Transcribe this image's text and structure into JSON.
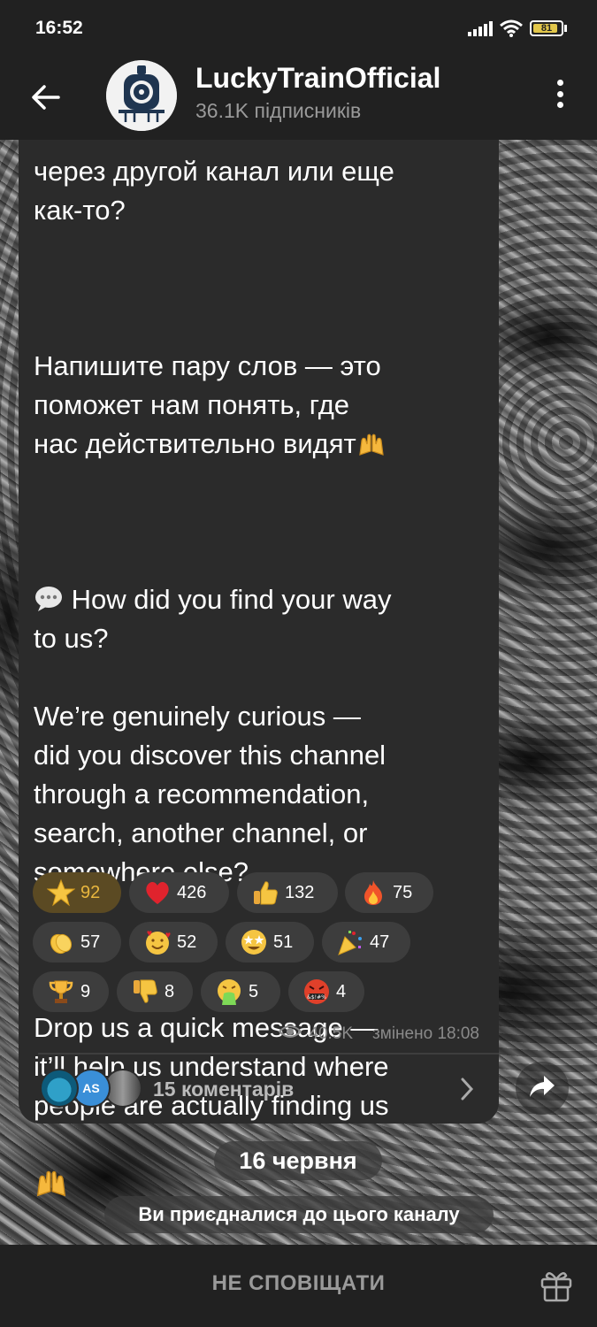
{
  "status_bar": {
    "time": "16:52",
    "battery": "81"
  },
  "header": {
    "title": "LuckyTrainOfficial",
    "subtitle": "36.1K підписників"
  },
  "message": {
    "text_ru_tail": "через другой канал или еще\nкак-то?",
    "text_ru_p2": "Напишите пару слов — это\nпоможет нам понять, где\nнас действительно видят",
    "text_en_q": " How did you find your way\nto us?",
    "text_en_p1": "We’re genuinely curious —\ndid you discover this channel\nthrough a recommendation,\nsearch, another channel, or\nsomewhere else?",
    "text_en_p2": "Drop us a quick message —\nit’ll help us understand where\npeople are actually finding us",
    "views": "40.5K",
    "edited": "змінено 18:08"
  },
  "reactions": [
    {
      "emoji": "star",
      "count": "92",
      "active": true
    },
    {
      "emoji": "heart",
      "count": "426"
    },
    {
      "emoji": "thumbs-up",
      "count": "132"
    },
    {
      "emoji": "fire",
      "count": "75"
    },
    {
      "emoji": "clapping-hands",
      "count": "57"
    },
    {
      "emoji": "smiling-face-with-hearts",
      "count": "52"
    },
    {
      "emoji": "star-struck",
      "count": "51"
    },
    {
      "emoji": "party-popper",
      "count": "47"
    },
    {
      "emoji": "trophy",
      "count": "9"
    },
    {
      "emoji": "thumbs-down",
      "count": "8"
    },
    {
      "emoji": "vomiting-face",
      "count": "5"
    },
    {
      "emoji": "cursing-face",
      "count": "4"
    }
  ],
  "comments": {
    "label": "15 коментарів",
    "avatar_initials": "AS"
  },
  "date_separator": "16 червня",
  "service_message": "Ви приєдналися до цього каналу",
  "bottom": {
    "mute_label": "НЕ СПОВІЩАТИ"
  }
}
